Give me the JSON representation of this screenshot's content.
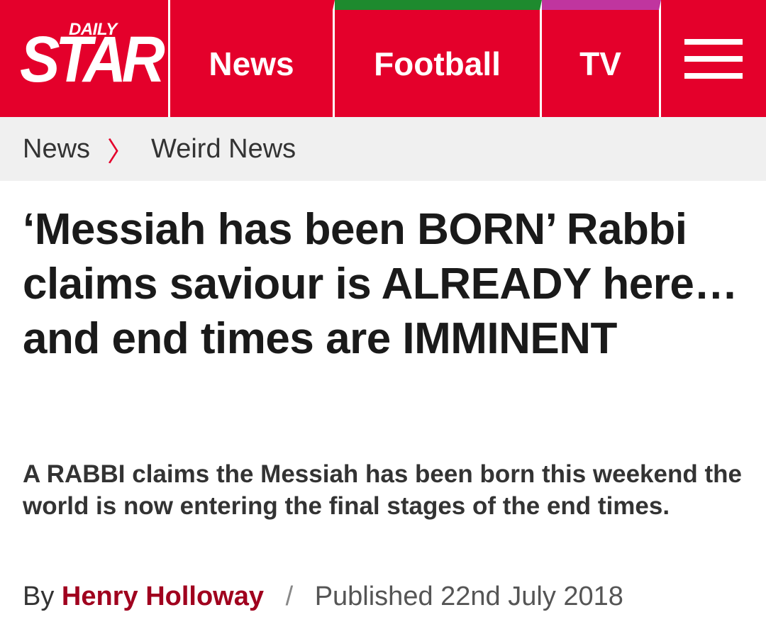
{
  "header": {
    "logo_small": "DAILY",
    "logo_big": "STAR",
    "nav": [
      {
        "label": "News"
      },
      {
        "label": "Football"
      },
      {
        "label": "TV"
      }
    ],
    "colors": {
      "brand": "#e4002b",
      "football_accent": "#1e8a2e",
      "tv_accent": "#c0359f"
    }
  },
  "breadcrumb": {
    "items": [
      "News",
      "Weird News"
    ],
    "separator": "〉"
  },
  "article": {
    "headline": "‘Messiah has been BORN’ Rabbi claims saviour is ALREADY here…and end times are IMMINENT",
    "standfirst": "A RABBI claims the Messiah has been born this weekend the world is now entering the final stages of the end times.",
    "byline_prefix": "By",
    "author": "Henry Holloway",
    "separator": "/",
    "published": "Published 22nd July 2018"
  }
}
